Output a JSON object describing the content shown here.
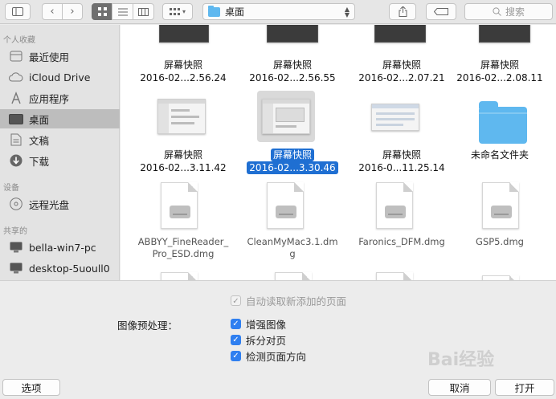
{
  "toolbar": {
    "path_label": "桌面",
    "search_placeholder": "搜索"
  },
  "sidebar": {
    "favorites_header": "个人收藏",
    "favorites": [
      {
        "label": "最近使用",
        "icon": "recents-icon"
      },
      {
        "label": "iCloud Drive",
        "icon": "cloud-icon"
      },
      {
        "label": "应用程序",
        "icon": "applications-icon"
      },
      {
        "label": "桌面",
        "icon": "desktop-icon",
        "selected": true
      },
      {
        "label": "文稿",
        "icon": "documents-icon"
      },
      {
        "label": "下载",
        "icon": "downloads-icon"
      }
    ],
    "devices_header": "设备",
    "devices": [
      {
        "label": "远程光盘",
        "icon": "disc-icon"
      }
    ],
    "shared_header": "共享的",
    "shared": [
      {
        "label": "bella-win7-pc",
        "icon": "pc-icon"
      },
      {
        "label": "desktop-5uoull0",
        "icon": "pc-icon"
      }
    ]
  },
  "files": {
    "row1": [
      {
        "line1": "屏幕快照",
        "line2": "2016-02...2.56.24"
      },
      {
        "line1": "屏幕快照",
        "line2": "2016-02...2.56.55"
      },
      {
        "line1": "屏幕快照",
        "line2": "2016-02...2.07.21"
      },
      {
        "line1": "屏幕快照",
        "line2": "2016-02...2.08.11"
      }
    ],
    "row2": [
      {
        "line1": "屏幕快照",
        "line2": "2016-02...3.11.42"
      },
      {
        "line1": "屏幕快照",
        "line2": "2016-02...3.30.46",
        "selected": true
      },
      {
        "line1": "屏幕快照",
        "line2": "2016-0...11.25.14"
      },
      {
        "line1": "未命名文件夹",
        "line2": ""
      }
    ],
    "row3": [
      {
        "line1": "ABBYY_FineReader_",
        "line2": "Pro_ESD.dmg"
      },
      {
        "line1": "CleanMyMac3.1.dm",
        "line2": "g"
      },
      {
        "line1": "Faronics_DFM.dmg",
        "line2": ""
      },
      {
        "line1": "GSP5.dmg",
        "line2": ""
      }
    ]
  },
  "options": {
    "auto_read_label": "自动读取新添加的页面",
    "preprocess_label": "图像预处理：",
    "enhance_label": "增强图像",
    "split_label": "拆分对页",
    "detect_label": "检测页面方向"
  },
  "buttons": {
    "options": "选项",
    "cancel": "取消",
    "open": "打开"
  },
  "watermark": "Bai经验"
}
